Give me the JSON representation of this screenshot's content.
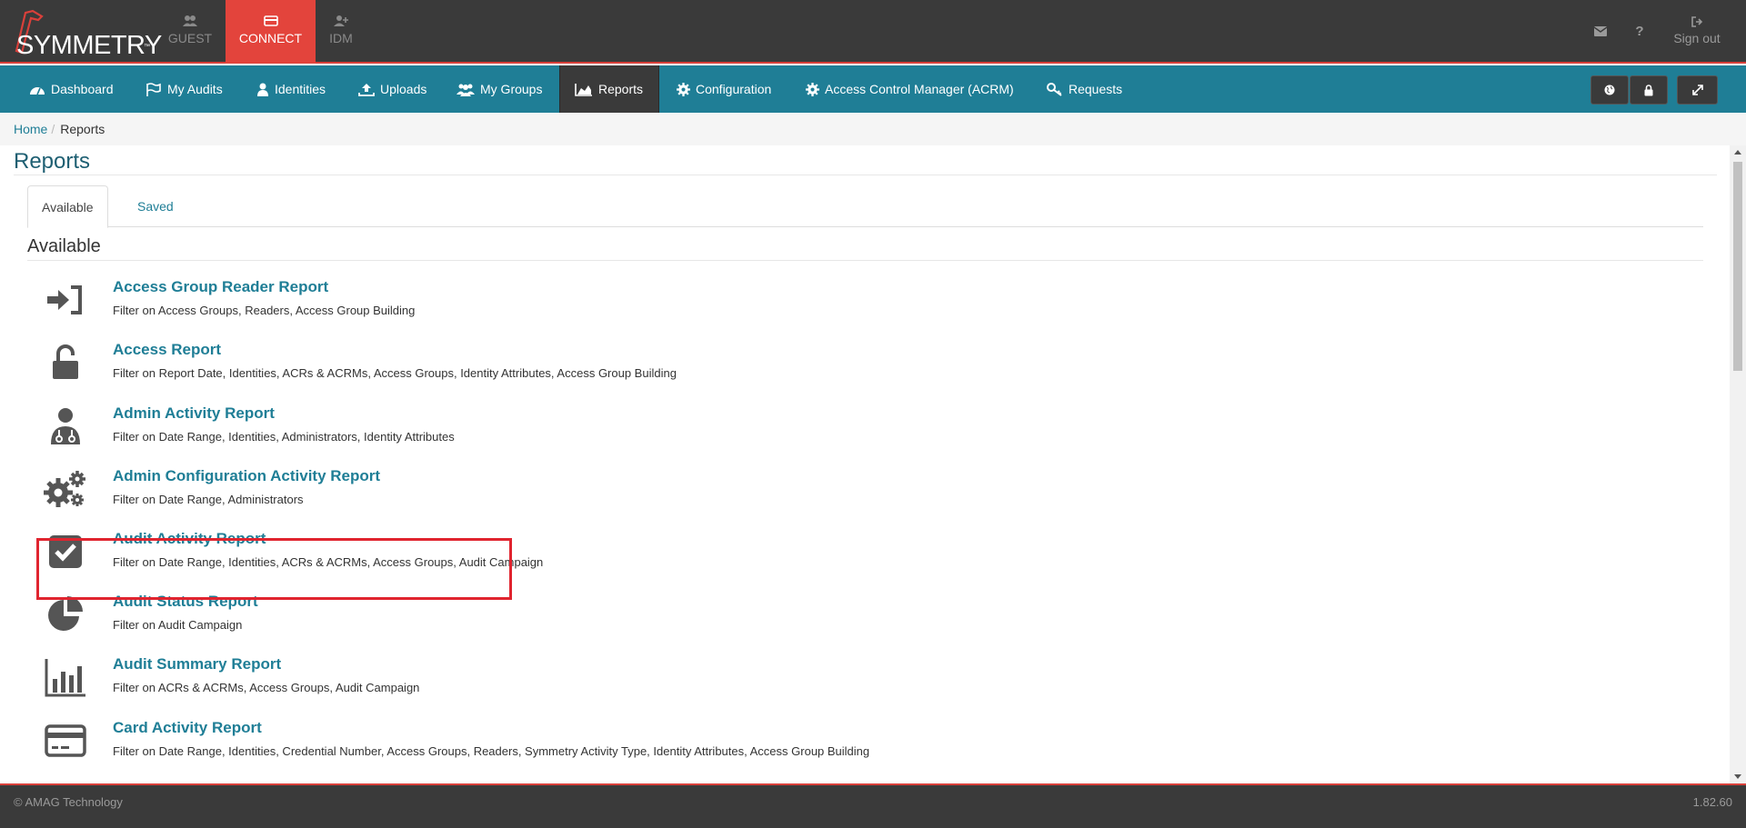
{
  "header": {
    "logo_text": "SYMMETRY",
    "logo_tm": "™",
    "top_nav": [
      {
        "label": "GUEST",
        "icon": "users-icon"
      },
      {
        "label": "CONNECT",
        "icon": "card-icon"
      },
      {
        "label": "IDM",
        "icon": "user-add-icon"
      }
    ],
    "mail_icon": "envelope-icon",
    "help_label": "?",
    "signout_label": "Sign out"
  },
  "nav": {
    "items": [
      {
        "label": "Dashboard",
        "icon": "dashboard-icon"
      },
      {
        "label": "My Audits",
        "icon": "flag-icon"
      },
      {
        "label": "Identities",
        "icon": "user-icon"
      },
      {
        "label": "Uploads",
        "icon": "upload-icon"
      },
      {
        "label": "My Groups",
        "icon": "group-icon"
      },
      {
        "label": "Reports",
        "icon": "area-chart-icon"
      },
      {
        "label": "Configuration",
        "icon": "gear-icon"
      },
      {
        "label": "Access Control Manager (ACRM)",
        "icon": "gear-icon"
      },
      {
        "label": "Requests",
        "icon": "key-icon"
      }
    ],
    "active": "Reports"
  },
  "breadcrumb": {
    "home": "Home",
    "sep": "/",
    "current": "Reports"
  },
  "page": {
    "title": "Reports",
    "tabs": [
      {
        "label": "Available"
      },
      {
        "label": "Saved"
      }
    ],
    "section_title": "Available"
  },
  "reports": [
    {
      "title": "Access Group Reader Report",
      "desc": "Filter on Access Groups, Readers, Access Group Building",
      "icon": "sign-in-icon"
    },
    {
      "title": "Access Report",
      "desc": "Filter on Report Date, Identities, ACRs & ACRMs, Access Groups, Identity Attributes, Access Group Building",
      "icon": "unlock-icon"
    },
    {
      "title": "Admin Activity Report",
      "desc": "Filter on Date Range, Identities, Administrators, Identity Attributes",
      "icon": "user-md-icon"
    },
    {
      "title": "Admin Configuration Activity Report",
      "desc": "Filter on Date Range, Administrators",
      "icon": "gears-icon"
    },
    {
      "title": "Audit Activity Report",
      "desc": "Filter on Date Range, Identities, ACRs & ACRMs, Access Groups, Audit Campaign",
      "icon": "check-square-icon"
    },
    {
      "title": "Audit Status Report",
      "desc": "Filter on Audit Campaign",
      "icon": "pie-chart-icon"
    },
    {
      "title": "Audit Summary Report",
      "desc": "Filter on ACRs & ACRMs, Access Groups, Audit Campaign",
      "icon": "bar-chart-icon"
    },
    {
      "title": "Card Activity Report",
      "desc": "Filter on Date Range, Identities, Credential Number, Access Groups, Readers, Symmetry Activity Type, Identity Attributes, Access Group Building",
      "icon": "credit-card-icon"
    }
  ],
  "footer": {
    "copyright": "© AMAG Technology",
    "version": "1.82.60"
  }
}
